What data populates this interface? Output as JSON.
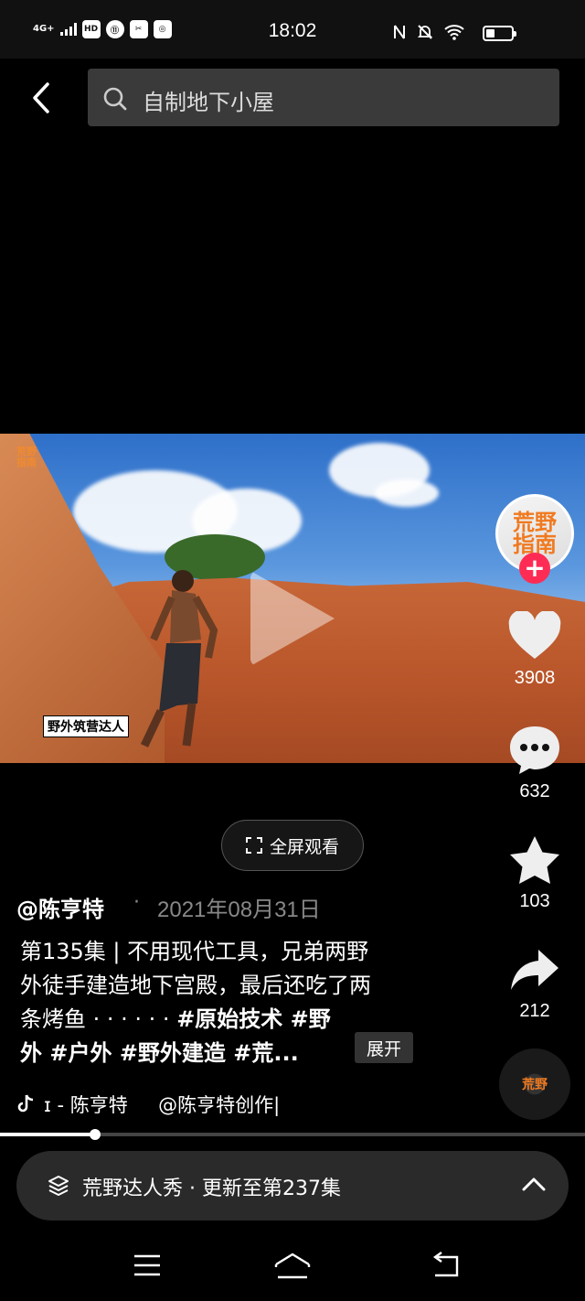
{
  "status_bar": {
    "network": "4G+",
    "icon_labels": [
      "HD",
      "⑪",
      "✂",
      "◎"
    ],
    "time": "18:02",
    "battery_level": 0.35
  },
  "search": {
    "query": "自制地下小屋"
  },
  "video": {
    "watermark_logo": "荒野\n指南",
    "watermark_subtitle": "野外筑营达人"
  },
  "rail": {
    "avatar_text": "荒野\n指南",
    "likes": "3908",
    "comments": "632",
    "favorites": "103",
    "shares": "212",
    "disc_text": "荒野"
  },
  "fullscreen_label": "全屏观看",
  "post": {
    "author": "@陈亨特",
    "separator": "·",
    "date": "2021年08月31日",
    "desc_line1": "第135集 | 不用现代工具，兄弟两野",
    "desc_line2": "外徒手建造地下宫殿，最后还吃了两",
    "desc_line3_plain": "条烤鱼 · · · · · · ",
    "desc_line3_tags": "#原始技术 #野",
    "desc_line4": "外 #户外 #野外建造 #荒...",
    "expand_label": "展开",
    "music": "ɪ - 陈亨特     @陈亨特创作|"
  },
  "playback": {
    "progress": 0.162
  },
  "series_bar": {
    "label": "荒野达人秀 · 更新至第237集"
  },
  "colors": {
    "accent_pink": "#fe2c55",
    "brand_orange": "#f07a20"
  }
}
